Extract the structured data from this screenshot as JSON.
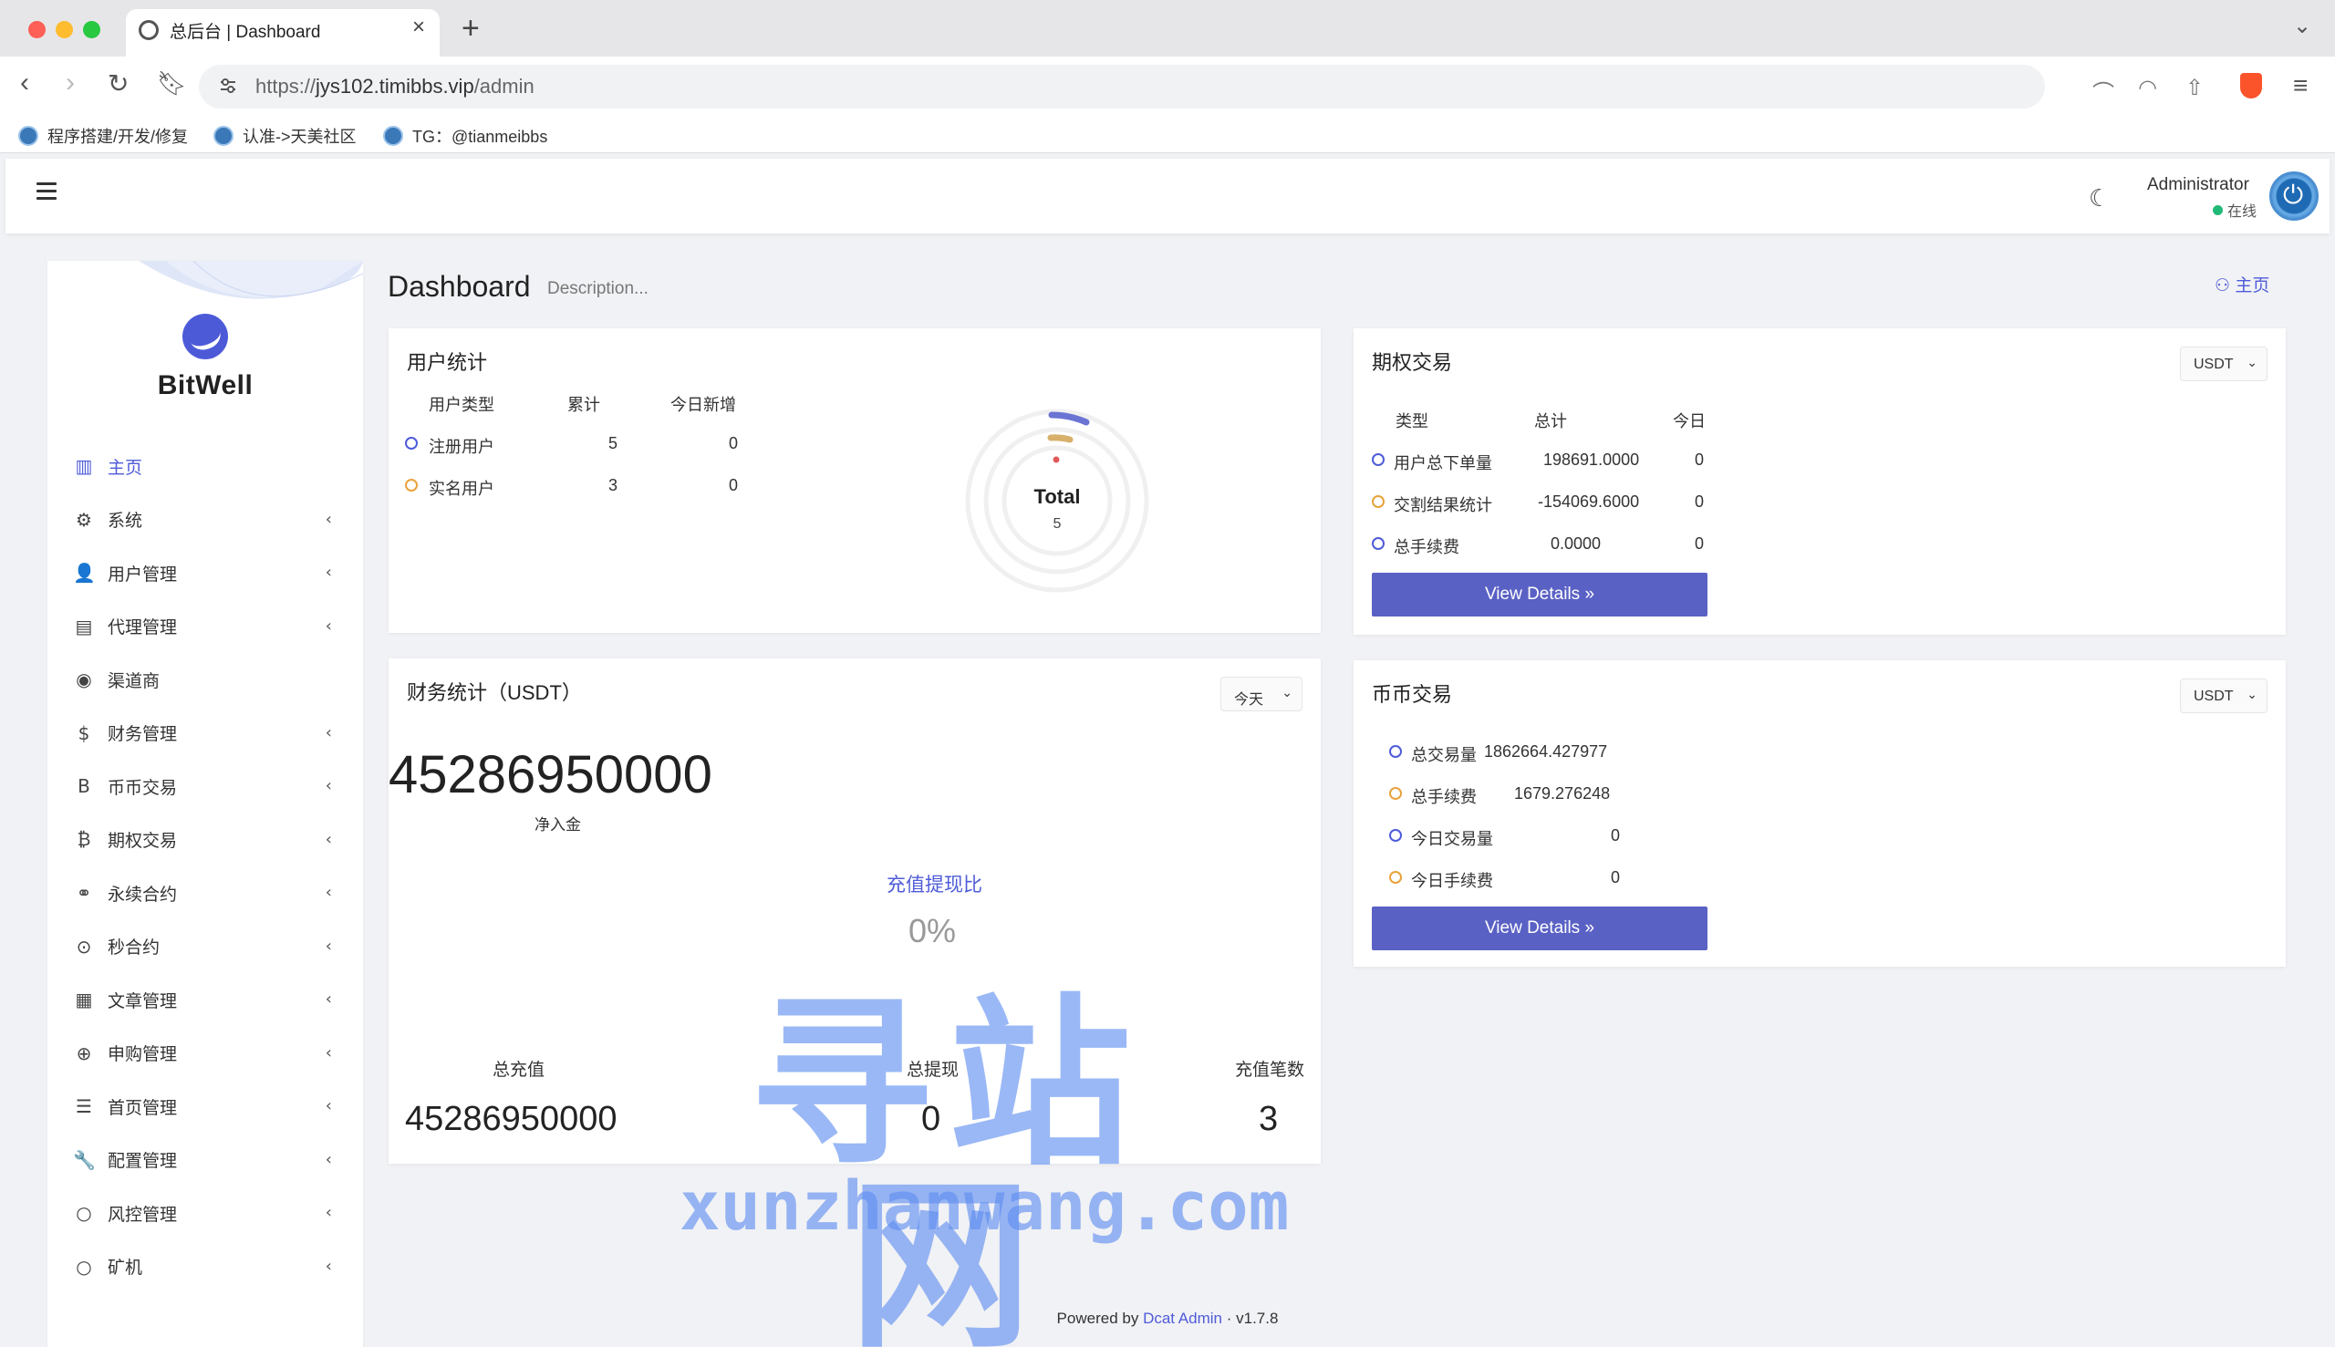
{
  "browser": {
    "tab_title": "总后台 | Dashboard",
    "url_prefix": "https://",
    "url_host": "jys102.timibbs.vip",
    "url_path": "/admin",
    "bookmarks": [
      "程序搭建/开发/修复",
      "认准->天美社区",
      "TG：@tianmeibbs"
    ]
  },
  "navbar": {
    "admin_name": "Administrator",
    "status": "在线"
  },
  "sidebar": {
    "brand": "BitWell",
    "items": [
      {
        "label": "主页",
        "icon": "chart-bar-icon",
        "glyph": "▥",
        "active": true,
        "expandable": false
      },
      {
        "label": "系统",
        "icon": "gear-icon",
        "glyph": "⚙",
        "active": false,
        "expandable": true
      },
      {
        "label": "用户管理",
        "icon": "user-tie-icon",
        "glyph": "👤",
        "active": false,
        "expandable": true
      },
      {
        "label": "代理管理",
        "icon": "id-card-icon",
        "glyph": "▤",
        "active": false,
        "expandable": true
      },
      {
        "label": "渠道商",
        "icon": "user-circle-icon",
        "glyph": "◉",
        "active": false,
        "expandable": false
      },
      {
        "label": "财务管理",
        "icon": "dollar-icon",
        "glyph": "$",
        "active": false,
        "expandable": true
      },
      {
        "label": "币币交易",
        "icon": "b-letter-icon",
        "glyph": "B",
        "active": false,
        "expandable": true
      },
      {
        "label": "期权交易",
        "icon": "bitcoin-icon",
        "glyph": "₿",
        "active": false,
        "expandable": true
      },
      {
        "label": "永续合约",
        "icon": "link-icon",
        "glyph": "⚭",
        "active": false,
        "expandable": true
      },
      {
        "label": "秒合约",
        "icon": "dot-circle-icon",
        "glyph": "⊙",
        "active": false,
        "expandable": true
      },
      {
        "label": "文章管理",
        "icon": "newspaper-icon",
        "glyph": "▦",
        "active": false,
        "expandable": true
      },
      {
        "label": "申购管理",
        "icon": "life-ring-icon",
        "glyph": "⊕",
        "active": false,
        "expandable": true
      },
      {
        "label": "首页管理",
        "icon": "list-icon",
        "glyph": "☰",
        "active": false,
        "expandable": true
      },
      {
        "label": "配置管理",
        "icon": "wrench-icon",
        "glyph": "🔧",
        "active": false,
        "expandable": true
      },
      {
        "label": "风控管理",
        "icon": "circle-icon",
        "glyph": "○",
        "active": false,
        "expandable": true
      },
      {
        "label": "矿机",
        "icon": "circle-icon",
        "glyph": "○",
        "active": false,
        "expandable": true
      }
    ]
  },
  "page": {
    "title": "Dashboard",
    "description": "Description...",
    "breadcrumb": "主页"
  },
  "user_stats": {
    "title": "用户统计",
    "headers": [
      "用户类型",
      "累计",
      "今日新增"
    ],
    "rows": [
      {
        "type": "注册用户",
        "total": "5",
        "today": "0",
        "color": "#4e5bd8"
      },
      {
        "type": "实名用户",
        "total": "3",
        "today": "0",
        "color": "#e8a23b"
      }
    ],
    "donut_label": "Total",
    "donut_value": "5"
  },
  "options_trade": {
    "title": "期权交易",
    "currency": "USDT",
    "headers": [
      "类型",
      "总计",
      "今日"
    ],
    "rows": [
      {
        "type": "用户总下单量",
        "total": "198691.0000",
        "today": "0"
      },
      {
        "type": "交割结果统计",
        "total": "-154069.6000",
        "today": "0"
      },
      {
        "type": "总手续费",
        "total": "0.0000",
        "today": "0"
      }
    ],
    "button": "View Details »"
  },
  "finance": {
    "title": "财务统计（USDT）",
    "period": "今天",
    "net_amount": "45286950000",
    "net_label": "净入金",
    "ratio_label": "充值提现比",
    "ratio_value": "0%",
    "total_deposit_label": "总充值",
    "total_deposit": "45286950000",
    "total_withdraw_label": "总提现",
    "total_withdraw": "0",
    "deposit_count_label": "充值笔数",
    "deposit_count": "3"
  },
  "coin_trade": {
    "title": "币币交易",
    "currency": "USDT",
    "rows": [
      {
        "label": "总交易量",
        "value": "1862664.427977"
      },
      {
        "label": "总手续费",
        "value": "1679.276248"
      },
      {
        "label": "今日交易量",
        "value": "0"
      },
      {
        "label": "今日手续费",
        "value": "0"
      }
    ],
    "button": "View Details »"
  },
  "watermark": {
    "cn": "寻站网",
    "en": "xunzhanwang.com"
  },
  "footer": {
    "prefix": "Powered by",
    "link": "Dcat Admin",
    "version": "·  v1.7.8"
  },
  "colors": {
    "accent": "#4e5bd8",
    "button": "#5a61c4",
    "orange": "#e8a23b",
    "online": "#21b978"
  }
}
